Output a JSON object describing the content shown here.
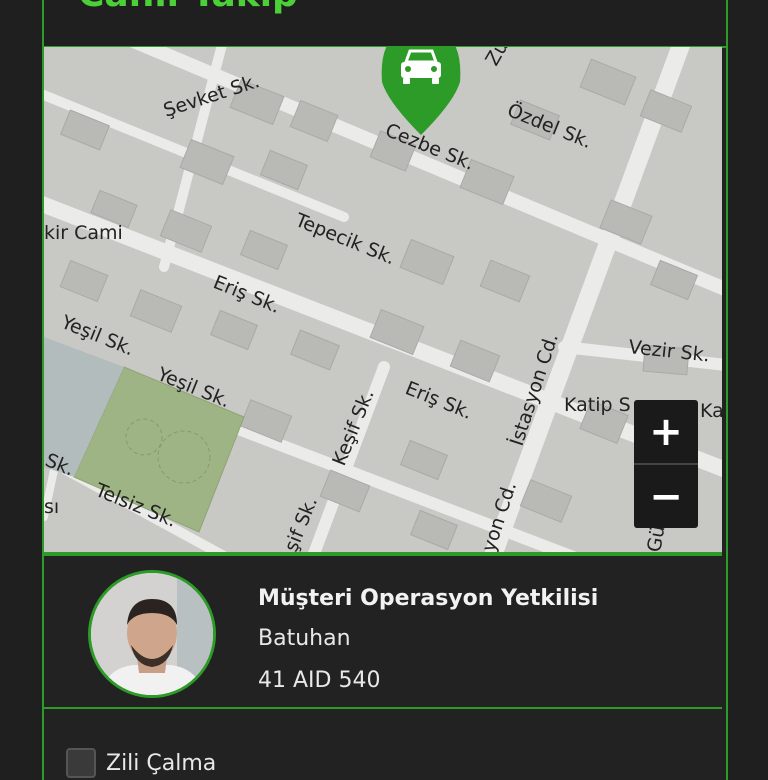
{
  "header": {
    "title": "Canlı Takip"
  },
  "map": {
    "streets": {
      "sevket": "Şevket Sk.",
      "cezbe": "Cezbe Sk.",
      "ozdel": "Özdel Sk.",
      "zu": "Zü",
      "cami": "kir Cami",
      "tepecik": "Tepecik Sk.",
      "eris1": "Eriş Sk.",
      "eris2": "Eriş Sk.",
      "yesil1": "Yeşil Sk.",
      "yesil2": "Yeşil Sk.",
      "kesif1": "Keşif Sk.",
      "kesif2": "şif Sk.",
      "istasyon1": "İstasyon Cd.",
      "istasyon2": "yon Cd.",
      "vezir": "Vezir Sk.",
      "katip": "Katip S",
      "ka": "Ka",
      "telsiz": "Telsiz Sk.",
      "sk": "Sk.",
      "si": "sı",
      "gu": "Gü"
    },
    "zoom_in_label": "+",
    "zoom_out_label": "−",
    "marker_icon": "car-icon",
    "accent_color": "#2d9b27"
  },
  "driver": {
    "role": "Müşteri Operasyon Yetkilisi",
    "name": "Batuhan",
    "plate": "41 AID 540"
  },
  "options": {
    "ring_label": "Zili Çalma"
  }
}
